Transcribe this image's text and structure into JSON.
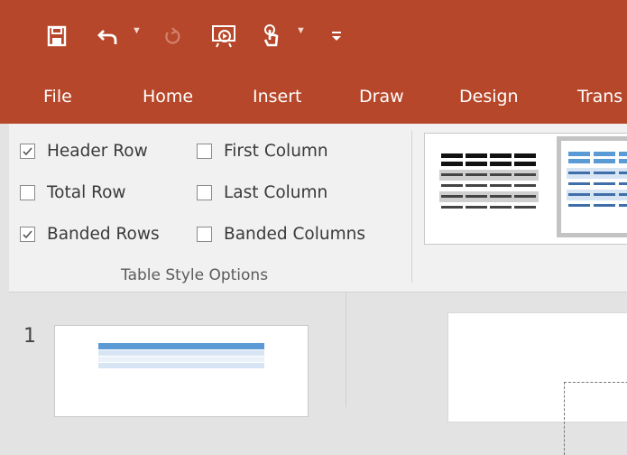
{
  "quick_access": {
    "items": [
      {
        "name": "save-icon",
        "disabled": false
      },
      {
        "name": "undo-icon",
        "disabled": false
      },
      {
        "name": "redo-icon",
        "disabled": true
      },
      {
        "name": "present-from-start-icon",
        "disabled": false
      },
      {
        "name": "touch-mode-icon",
        "disabled": false
      },
      {
        "name": "customize-qat-icon",
        "disabled": false
      }
    ]
  },
  "tabs": [
    "File",
    "Home",
    "Insert",
    "Draw",
    "Design",
    "Trans"
  ],
  "table_style_options": {
    "options": [
      {
        "label": "Header Row",
        "checked": true
      },
      {
        "label": "First Column",
        "checked": false
      },
      {
        "label": "Total Row",
        "checked": false
      },
      {
        "label": "Last Column",
        "checked": false
      },
      {
        "label": "Banded Rows",
        "checked": true
      },
      {
        "label": "Banded Columns",
        "checked": false
      }
    ],
    "group_label": "Table Style Options"
  },
  "slides": {
    "first_number": "1"
  },
  "colors": {
    "ribbon_accent": "#b7472a",
    "table_style_blue": "#5b9bd5"
  }
}
